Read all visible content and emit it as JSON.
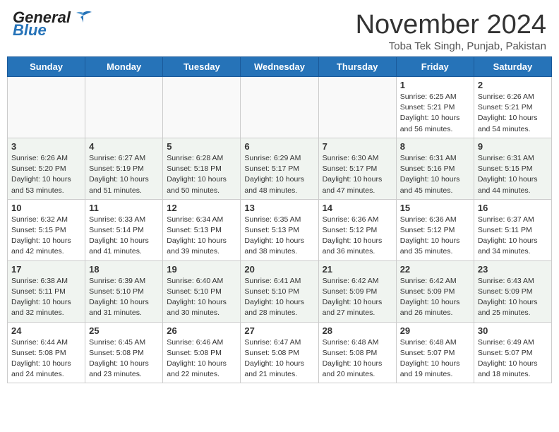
{
  "header": {
    "logo_general": "General",
    "logo_blue": "Blue",
    "month_year": "November 2024",
    "location": "Toba Tek Singh, Punjab, Pakistan"
  },
  "calendar": {
    "days_of_week": [
      "Sunday",
      "Monday",
      "Tuesday",
      "Wednesday",
      "Thursday",
      "Friday",
      "Saturday"
    ],
    "weeks": [
      [
        {
          "day": "",
          "empty": true
        },
        {
          "day": "",
          "empty": true
        },
        {
          "day": "",
          "empty": true
        },
        {
          "day": "",
          "empty": true
        },
        {
          "day": "",
          "empty": true
        },
        {
          "day": "1",
          "info": "Sunrise: 6:25 AM\nSunset: 5:21 PM\nDaylight: 10 hours and 56 minutes."
        },
        {
          "day": "2",
          "info": "Sunrise: 6:26 AM\nSunset: 5:21 PM\nDaylight: 10 hours and 54 minutes."
        }
      ],
      [
        {
          "day": "3",
          "info": "Sunrise: 6:26 AM\nSunset: 5:20 PM\nDaylight: 10 hours and 53 minutes."
        },
        {
          "day": "4",
          "info": "Sunrise: 6:27 AM\nSunset: 5:19 PM\nDaylight: 10 hours and 51 minutes."
        },
        {
          "day": "5",
          "info": "Sunrise: 6:28 AM\nSunset: 5:18 PM\nDaylight: 10 hours and 50 minutes."
        },
        {
          "day": "6",
          "info": "Sunrise: 6:29 AM\nSunset: 5:17 PM\nDaylight: 10 hours and 48 minutes."
        },
        {
          "day": "7",
          "info": "Sunrise: 6:30 AM\nSunset: 5:17 PM\nDaylight: 10 hours and 47 minutes."
        },
        {
          "day": "8",
          "info": "Sunrise: 6:31 AM\nSunset: 5:16 PM\nDaylight: 10 hours and 45 minutes."
        },
        {
          "day": "9",
          "info": "Sunrise: 6:31 AM\nSunset: 5:15 PM\nDaylight: 10 hours and 44 minutes."
        }
      ],
      [
        {
          "day": "10",
          "info": "Sunrise: 6:32 AM\nSunset: 5:15 PM\nDaylight: 10 hours and 42 minutes."
        },
        {
          "day": "11",
          "info": "Sunrise: 6:33 AM\nSunset: 5:14 PM\nDaylight: 10 hours and 41 minutes."
        },
        {
          "day": "12",
          "info": "Sunrise: 6:34 AM\nSunset: 5:13 PM\nDaylight: 10 hours and 39 minutes."
        },
        {
          "day": "13",
          "info": "Sunrise: 6:35 AM\nSunset: 5:13 PM\nDaylight: 10 hours and 38 minutes."
        },
        {
          "day": "14",
          "info": "Sunrise: 6:36 AM\nSunset: 5:12 PM\nDaylight: 10 hours and 36 minutes."
        },
        {
          "day": "15",
          "info": "Sunrise: 6:36 AM\nSunset: 5:12 PM\nDaylight: 10 hours and 35 minutes."
        },
        {
          "day": "16",
          "info": "Sunrise: 6:37 AM\nSunset: 5:11 PM\nDaylight: 10 hours and 34 minutes."
        }
      ],
      [
        {
          "day": "17",
          "info": "Sunrise: 6:38 AM\nSunset: 5:11 PM\nDaylight: 10 hours and 32 minutes."
        },
        {
          "day": "18",
          "info": "Sunrise: 6:39 AM\nSunset: 5:10 PM\nDaylight: 10 hours and 31 minutes."
        },
        {
          "day": "19",
          "info": "Sunrise: 6:40 AM\nSunset: 5:10 PM\nDaylight: 10 hours and 30 minutes."
        },
        {
          "day": "20",
          "info": "Sunrise: 6:41 AM\nSunset: 5:10 PM\nDaylight: 10 hours and 28 minutes."
        },
        {
          "day": "21",
          "info": "Sunrise: 6:42 AM\nSunset: 5:09 PM\nDaylight: 10 hours and 27 minutes."
        },
        {
          "day": "22",
          "info": "Sunrise: 6:42 AM\nSunset: 5:09 PM\nDaylight: 10 hours and 26 minutes."
        },
        {
          "day": "23",
          "info": "Sunrise: 6:43 AM\nSunset: 5:09 PM\nDaylight: 10 hours and 25 minutes."
        }
      ],
      [
        {
          "day": "24",
          "info": "Sunrise: 6:44 AM\nSunset: 5:08 PM\nDaylight: 10 hours and 24 minutes."
        },
        {
          "day": "25",
          "info": "Sunrise: 6:45 AM\nSunset: 5:08 PM\nDaylight: 10 hours and 23 minutes."
        },
        {
          "day": "26",
          "info": "Sunrise: 6:46 AM\nSunset: 5:08 PM\nDaylight: 10 hours and 22 minutes."
        },
        {
          "day": "27",
          "info": "Sunrise: 6:47 AM\nSunset: 5:08 PM\nDaylight: 10 hours and 21 minutes."
        },
        {
          "day": "28",
          "info": "Sunrise: 6:48 AM\nSunset: 5:08 PM\nDaylight: 10 hours and 20 minutes."
        },
        {
          "day": "29",
          "info": "Sunrise: 6:48 AM\nSunset: 5:07 PM\nDaylight: 10 hours and 19 minutes."
        },
        {
          "day": "30",
          "info": "Sunrise: 6:49 AM\nSunset: 5:07 PM\nDaylight: 10 hours and 18 minutes."
        }
      ]
    ]
  }
}
